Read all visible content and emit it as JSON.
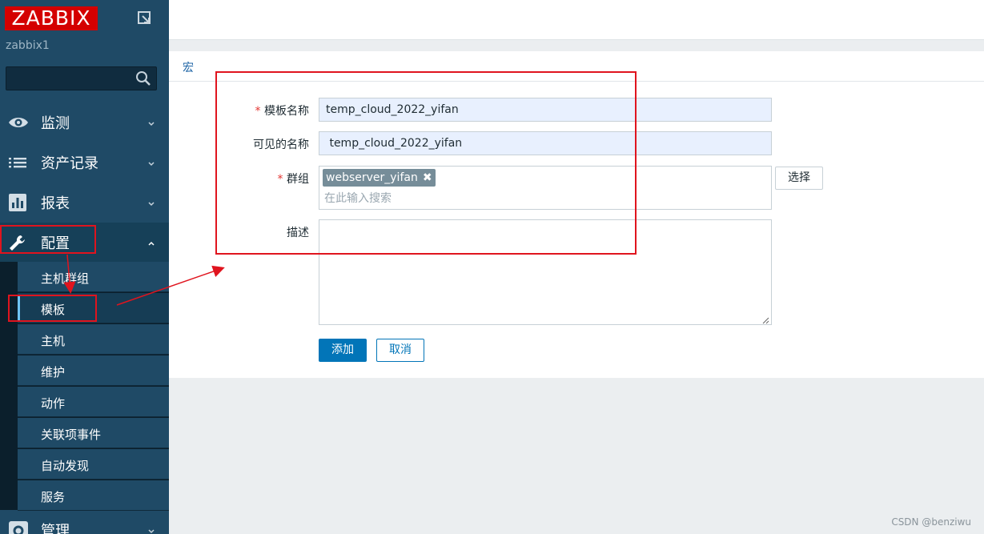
{
  "app": {
    "logo_text": "ZABBIX",
    "server_name": "zabbix1",
    "search_placeholder": ""
  },
  "sidebar": {
    "menu": [
      {
        "label": "监测",
        "icon": "eye-icon"
      },
      {
        "label": "资产记录",
        "icon": "list-icon"
      },
      {
        "label": "报表",
        "icon": "bar-chart-icon"
      },
      {
        "label": "配置",
        "icon": "wrench-icon"
      },
      {
        "label": "管理",
        "icon": "gear-icon"
      }
    ],
    "config_submenu": [
      "主机群组",
      "模板",
      "主机",
      "维护",
      "动作",
      "关联项事件",
      "自动发现",
      "服务"
    ],
    "active_submenu": "模板"
  },
  "tabs": {
    "macro": "宏"
  },
  "form": {
    "template_name_label": "模板名称",
    "template_name_value": "temp_cloud_2022_yifan",
    "visible_name_label": "可见的名称",
    "visible_name_value": " temp_cloud_2022_yifan",
    "groups_label": "群组",
    "group_chip": "webserver_yifan",
    "group_search_placeholder": "在此输入搜索",
    "select_button": "选择",
    "description_label": "描述",
    "description_value": "",
    "add_button": "添加",
    "cancel_button": "取消"
  },
  "colors": {
    "sidebar_bg": "#1f4a66",
    "primary": "#0275b8",
    "annotation": "#e0141e",
    "logo_bg": "#d40000"
  },
  "watermark": "CSDN @benziwu"
}
